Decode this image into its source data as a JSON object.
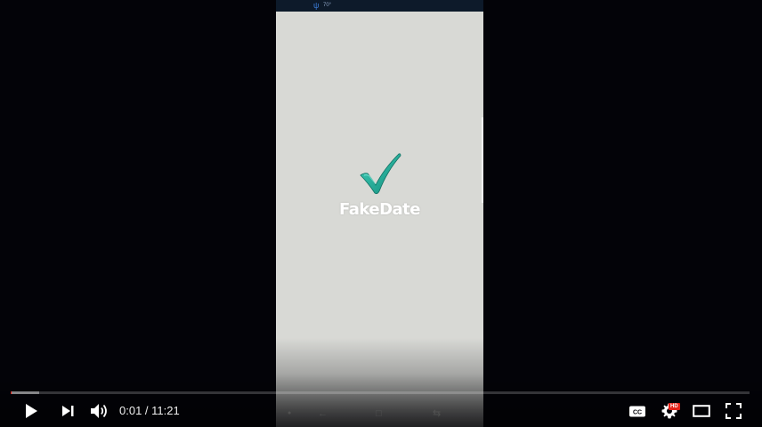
{
  "video": {
    "app_name": "FakeDate",
    "status_bar_text": "70°",
    "logo_color": "#26b3a0"
  },
  "player": {
    "current_time": "0:01",
    "separator": " / ",
    "duration": "11:21",
    "played_fraction": 0.0015,
    "loaded_fraction": 0.039,
    "hd_badge": "HD",
    "accent_color": "#e62117"
  },
  "icons": {
    "play": "play-icon",
    "next": "next-icon",
    "volume": "volume-icon",
    "captions": "captions-icon",
    "settings": "settings-gear-icon",
    "theater": "theater-mode-icon",
    "fullscreen": "fullscreen-icon"
  }
}
